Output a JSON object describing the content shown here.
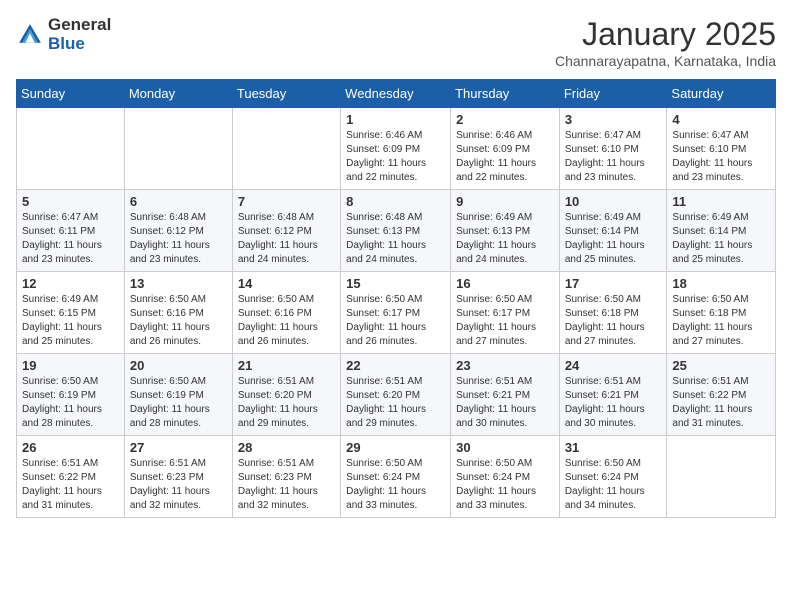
{
  "logo": {
    "general": "General",
    "blue": "Blue"
  },
  "title": "January 2025",
  "location": "Channarayapatna, Karnataka, India",
  "days_header": [
    "Sunday",
    "Monday",
    "Tuesday",
    "Wednesday",
    "Thursday",
    "Friday",
    "Saturday"
  ],
  "weeks": [
    [
      {
        "num": "",
        "info": ""
      },
      {
        "num": "",
        "info": ""
      },
      {
        "num": "",
        "info": ""
      },
      {
        "num": "1",
        "info": "Sunrise: 6:46 AM\nSunset: 6:09 PM\nDaylight: 11 hours and 22 minutes."
      },
      {
        "num": "2",
        "info": "Sunrise: 6:46 AM\nSunset: 6:09 PM\nDaylight: 11 hours and 22 minutes."
      },
      {
        "num": "3",
        "info": "Sunrise: 6:47 AM\nSunset: 6:10 PM\nDaylight: 11 hours and 23 minutes."
      },
      {
        "num": "4",
        "info": "Sunrise: 6:47 AM\nSunset: 6:10 PM\nDaylight: 11 hours and 23 minutes."
      }
    ],
    [
      {
        "num": "5",
        "info": "Sunrise: 6:47 AM\nSunset: 6:11 PM\nDaylight: 11 hours and 23 minutes."
      },
      {
        "num": "6",
        "info": "Sunrise: 6:48 AM\nSunset: 6:12 PM\nDaylight: 11 hours and 23 minutes."
      },
      {
        "num": "7",
        "info": "Sunrise: 6:48 AM\nSunset: 6:12 PM\nDaylight: 11 hours and 24 minutes."
      },
      {
        "num": "8",
        "info": "Sunrise: 6:48 AM\nSunset: 6:13 PM\nDaylight: 11 hours and 24 minutes."
      },
      {
        "num": "9",
        "info": "Sunrise: 6:49 AM\nSunset: 6:13 PM\nDaylight: 11 hours and 24 minutes."
      },
      {
        "num": "10",
        "info": "Sunrise: 6:49 AM\nSunset: 6:14 PM\nDaylight: 11 hours and 25 minutes."
      },
      {
        "num": "11",
        "info": "Sunrise: 6:49 AM\nSunset: 6:14 PM\nDaylight: 11 hours and 25 minutes."
      }
    ],
    [
      {
        "num": "12",
        "info": "Sunrise: 6:49 AM\nSunset: 6:15 PM\nDaylight: 11 hours and 25 minutes."
      },
      {
        "num": "13",
        "info": "Sunrise: 6:50 AM\nSunset: 6:16 PM\nDaylight: 11 hours and 26 minutes."
      },
      {
        "num": "14",
        "info": "Sunrise: 6:50 AM\nSunset: 6:16 PM\nDaylight: 11 hours and 26 minutes."
      },
      {
        "num": "15",
        "info": "Sunrise: 6:50 AM\nSunset: 6:17 PM\nDaylight: 11 hours and 26 minutes."
      },
      {
        "num": "16",
        "info": "Sunrise: 6:50 AM\nSunset: 6:17 PM\nDaylight: 11 hours and 27 minutes."
      },
      {
        "num": "17",
        "info": "Sunrise: 6:50 AM\nSunset: 6:18 PM\nDaylight: 11 hours and 27 minutes."
      },
      {
        "num": "18",
        "info": "Sunrise: 6:50 AM\nSunset: 6:18 PM\nDaylight: 11 hours and 27 minutes."
      }
    ],
    [
      {
        "num": "19",
        "info": "Sunrise: 6:50 AM\nSunset: 6:19 PM\nDaylight: 11 hours and 28 minutes."
      },
      {
        "num": "20",
        "info": "Sunrise: 6:50 AM\nSunset: 6:19 PM\nDaylight: 11 hours and 28 minutes."
      },
      {
        "num": "21",
        "info": "Sunrise: 6:51 AM\nSunset: 6:20 PM\nDaylight: 11 hours and 29 minutes."
      },
      {
        "num": "22",
        "info": "Sunrise: 6:51 AM\nSunset: 6:20 PM\nDaylight: 11 hours and 29 minutes."
      },
      {
        "num": "23",
        "info": "Sunrise: 6:51 AM\nSunset: 6:21 PM\nDaylight: 11 hours and 30 minutes."
      },
      {
        "num": "24",
        "info": "Sunrise: 6:51 AM\nSunset: 6:21 PM\nDaylight: 11 hours and 30 minutes."
      },
      {
        "num": "25",
        "info": "Sunrise: 6:51 AM\nSunset: 6:22 PM\nDaylight: 11 hours and 31 minutes."
      }
    ],
    [
      {
        "num": "26",
        "info": "Sunrise: 6:51 AM\nSunset: 6:22 PM\nDaylight: 11 hours and 31 minutes."
      },
      {
        "num": "27",
        "info": "Sunrise: 6:51 AM\nSunset: 6:23 PM\nDaylight: 11 hours and 32 minutes."
      },
      {
        "num": "28",
        "info": "Sunrise: 6:51 AM\nSunset: 6:23 PM\nDaylight: 11 hours and 32 minutes."
      },
      {
        "num": "29",
        "info": "Sunrise: 6:50 AM\nSunset: 6:24 PM\nDaylight: 11 hours and 33 minutes."
      },
      {
        "num": "30",
        "info": "Sunrise: 6:50 AM\nSunset: 6:24 PM\nDaylight: 11 hours and 33 minutes."
      },
      {
        "num": "31",
        "info": "Sunrise: 6:50 AM\nSunset: 6:24 PM\nDaylight: 11 hours and 34 minutes."
      },
      {
        "num": "",
        "info": ""
      }
    ]
  ]
}
